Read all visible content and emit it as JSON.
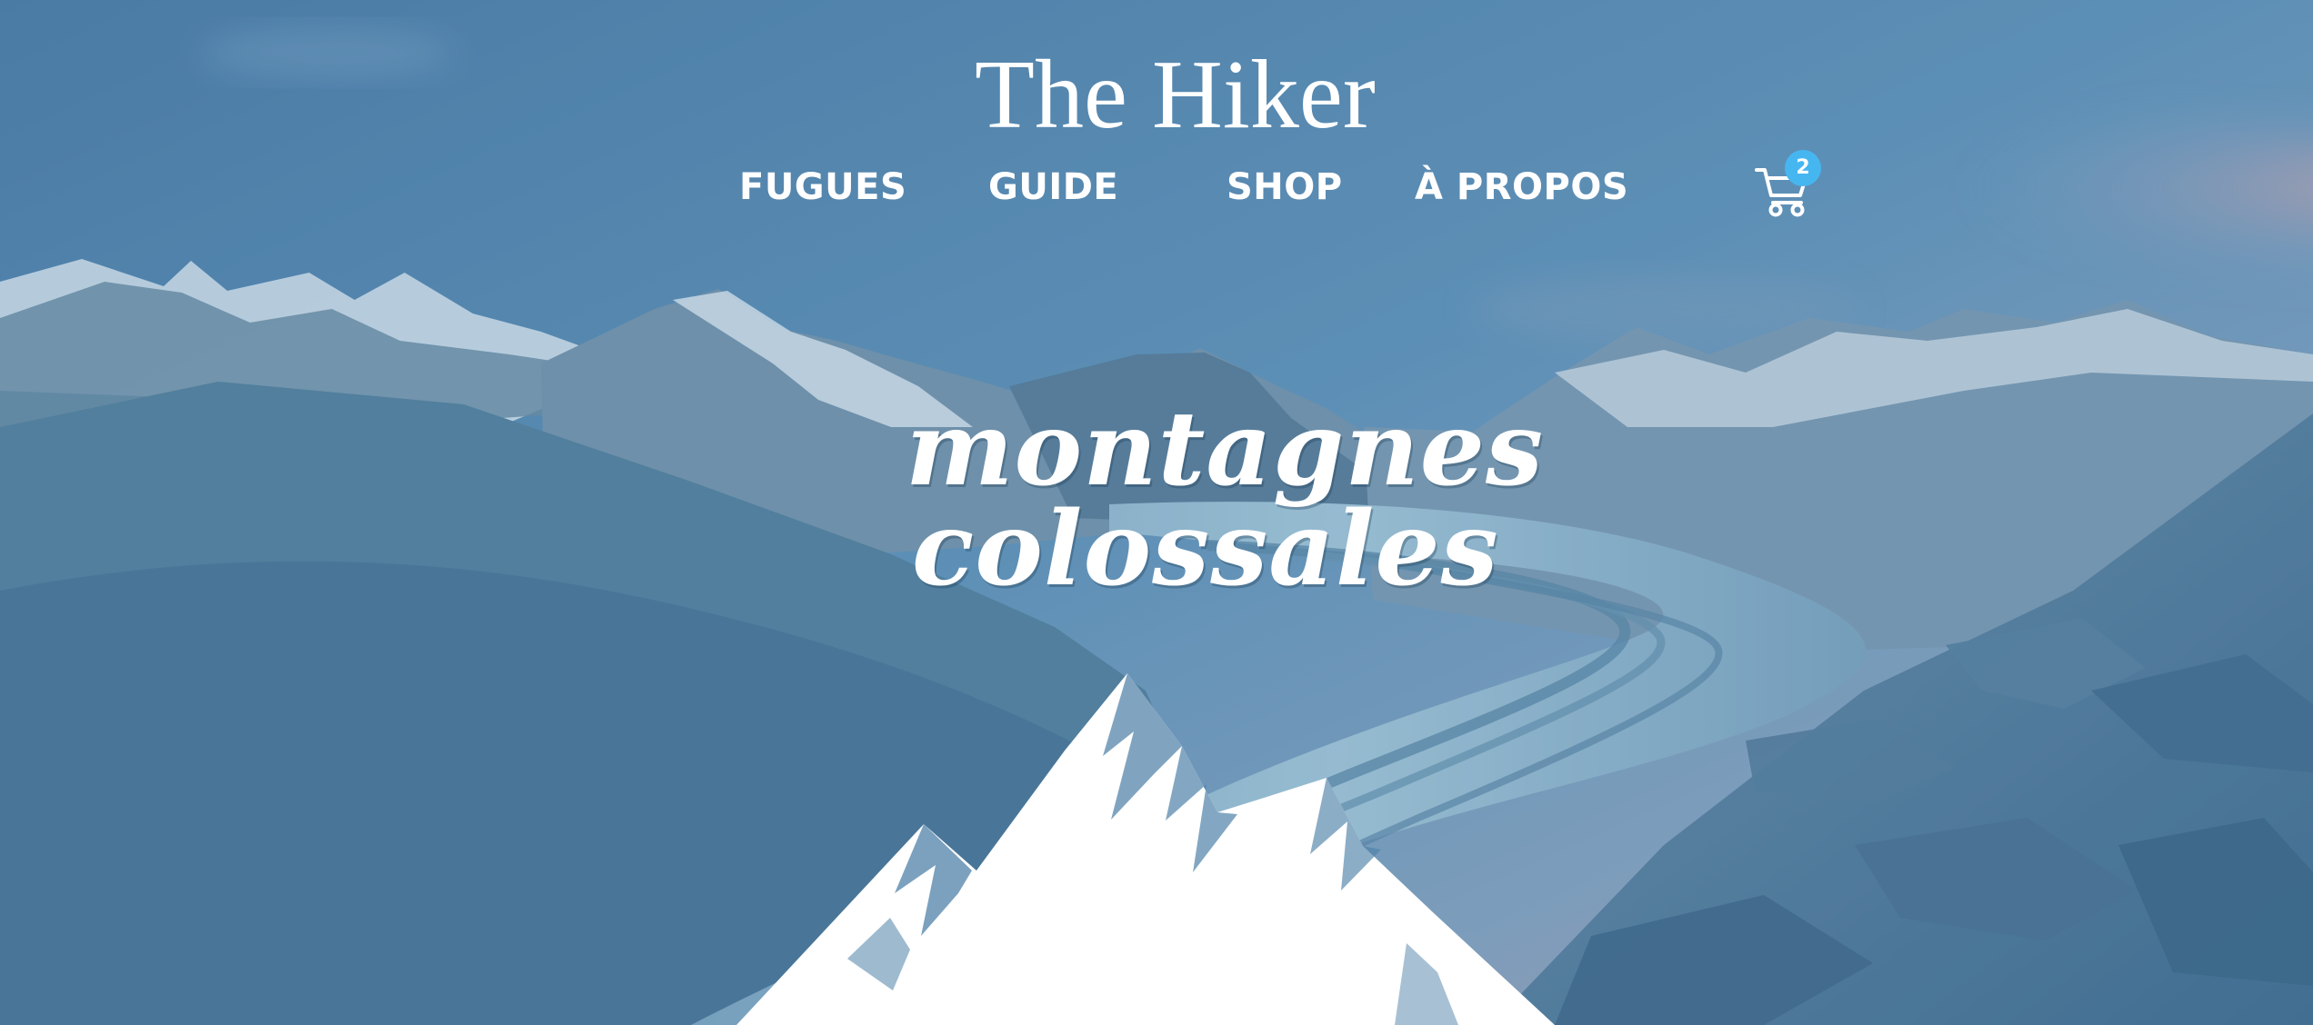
{
  "site": {
    "title": "The Hiker"
  },
  "navigation": {
    "items": [
      {
        "label": "FUGUES"
      },
      {
        "label": "GUIDE"
      },
      {
        "label": "SHOP"
      },
      {
        "label": "À PROPOS"
      }
    ]
  },
  "cart": {
    "icon": "shopping-cart-icon",
    "count": "2"
  },
  "hero": {
    "headline_line_1": "montagnes",
    "headline_line_2": "colossales",
    "logo": "mountain-logo"
  },
  "colors": {
    "overlay": "#4a86b2",
    "text": "#ffffff",
    "badge": "#46b6f1"
  }
}
